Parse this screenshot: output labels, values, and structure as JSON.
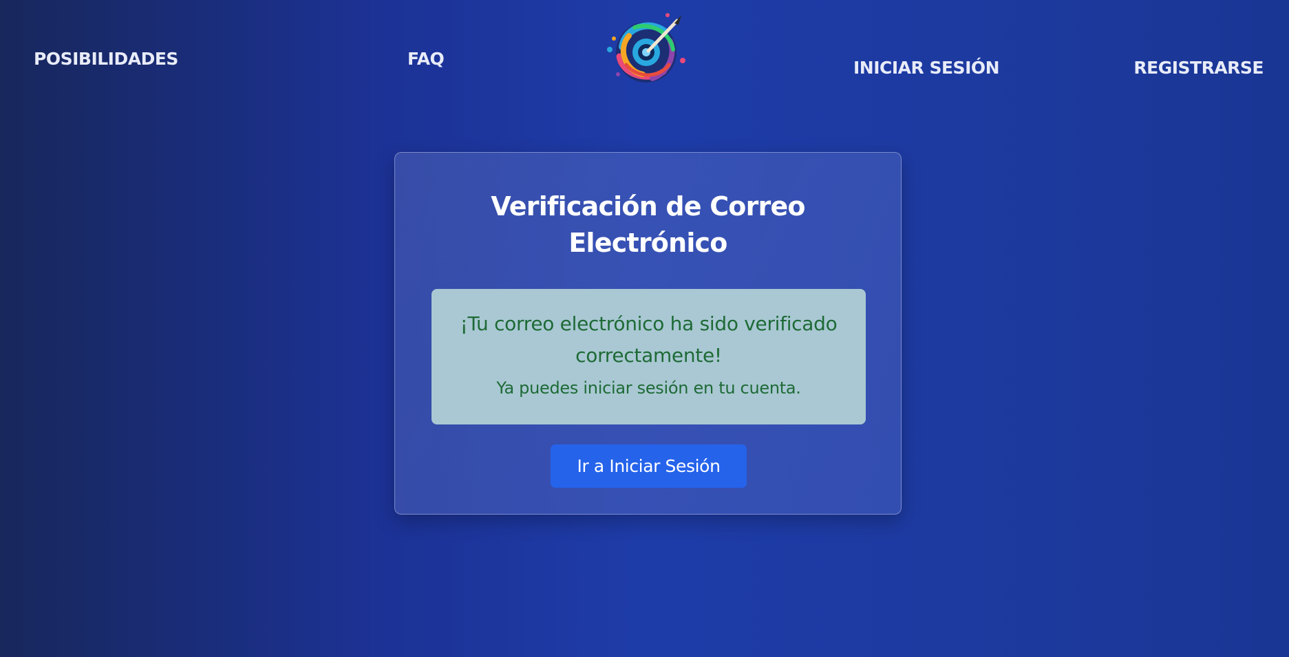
{
  "nav": {
    "possibilities": "POSIBILIDADES",
    "faq": "FAQ",
    "login": "INICIAR SESIÓN",
    "register": "REGISTRARSE"
  },
  "logo": {
    "icon": "palette-swirl-logo",
    "colors": [
      "#29a8e0",
      "#e84a7a",
      "#f5a623",
      "#8e44ad",
      "#2ecc71"
    ]
  },
  "card": {
    "title": "Verificación de Correo Electrónico",
    "alert": {
      "heading": "¡Tu correo electrónico ha sido verificado correctamente!",
      "text": "Ya puedes iniciar sesión en tu cuenta.",
      "color": "#1e6a36",
      "background": "#a9c8d3"
    },
    "button_label": "Ir a Iniciar Sesión",
    "button_color": "#2563eb"
  }
}
